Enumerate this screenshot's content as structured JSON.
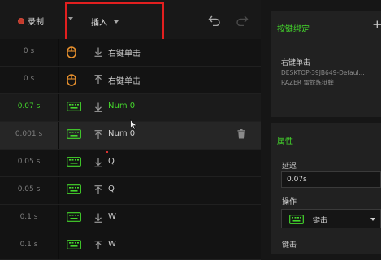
{
  "toolbar": {
    "record_label": "录制",
    "insert_label": "插入"
  },
  "rows": [
    {
      "time": "0 s",
      "device": "mouse",
      "direction": "down",
      "action": "右键单击"
    },
    {
      "time": "0 s",
      "device": "mouse",
      "direction": "up",
      "action": "右键单击"
    },
    {
      "time": "0.07 s",
      "device": "keyboard",
      "direction": "down",
      "action": "Num 0"
    },
    {
      "time": "0.001 s",
      "device": "keyboard",
      "direction": "up",
      "action": "Num 0"
    },
    {
      "time": "0.05 s",
      "device": "keyboard",
      "direction": "down",
      "action": "Q"
    },
    {
      "time": "0.05 s",
      "device": "keyboard",
      "direction": "up",
      "action": "Q"
    },
    {
      "time": "0.1 s",
      "device": "keyboard",
      "direction": "down",
      "action": "W"
    },
    {
      "time": "0.1 s",
      "device": "keyboard",
      "direction": "up",
      "action": "W"
    }
  ],
  "binding_panel": {
    "title": "按键绑定",
    "add_label": "+",
    "binding_name": "右键单击",
    "device": "DESKTOP-39JB649-Defaul...",
    "profile": "RAZER 雷蛇炼狱蝰"
  },
  "properties_panel": {
    "title": "属性",
    "delay_label": "延迟",
    "delay_value": "0.07s",
    "action_label": "操作",
    "action_value": "键击",
    "key_label": "键击"
  },
  "colors": {
    "accent_green": "#44d62c",
    "highlight_red": "#e21f1f",
    "record_red": "#c43a2b"
  }
}
